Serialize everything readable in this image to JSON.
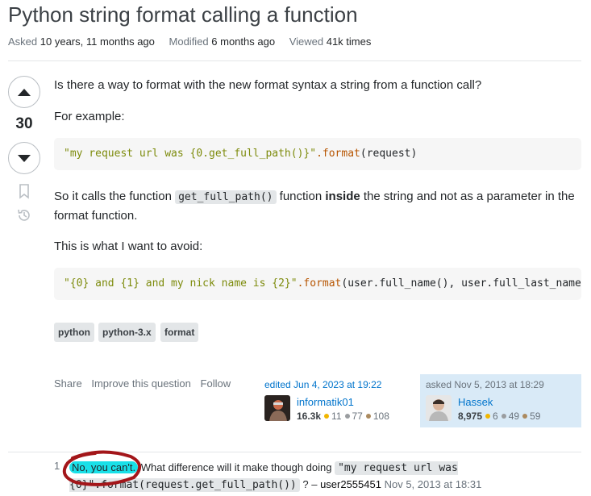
{
  "question": {
    "title": "Python string format calling a function",
    "meta": {
      "asked_label": "Asked",
      "asked_value": "10 years, 11 months ago",
      "modified_label": "Modified",
      "modified_value": "6 months ago",
      "viewed_label": "Viewed",
      "viewed_value": "41k times"
    },
    "score": "30",
    "paragraphs": {
      "p1": "Is there a way to format with the new format syntax a string from a function call?",
      "p2": "For example:",
      "p3_a": "So it calls the function ",
      "p3_code": "get_full_path()",
      "p3_b": " function ",
      "p3_bold": "inside",
      "p3_c": " the string and not as a parameter in the format function.",
      "p4": "This is what I want to avoid:"
    },
    "code1": {
      "str": "\"my request url was {0.get_full_path()}\"",
      "fn": ".format",
      "rest": "(request)"
    },
    "code2": {
      "str": "\"{0} and {1} and my nick name is {2}\"",
      "fn": ".format",
      "rest": "(user.full_name(), user.full_last_name(), user.nick_name)"
    },
    "tags": [
      "python",
      "python-3.x",
      "format"
    ],
    "actions": {
      "share": "Share",
      "improve": "Improve this question",
      "follow": "Follow"
    },
    "edited": {
      "time": "edited Jun 4, 2023 at 19:22",
      "user": "informatik01",
      "rep": "16.3k",
      "gold": "11",
      "silver": "77",
      "bronze": "108"
    },
    "asked": {
      "time": "asked Nov 5, 2013 at 18:29",
      "user": "Hassek",
      "rep": "8,975",
      "gold": "6",
      "silver": "49",
      "bronze": "59"
    }
  },
  "comment": {
    "score": "1",
    "highlight": "No, you can't.",
    "text_a": " What difference will it make though doing ",
    "code": "\"my request url was {0}\".format(request.get_full_path())",
    "text_b": " ? – ",
    "user": "user2555451",
    "date": "Nov 5, 2013 at 18:31"
  },
  "colors": {
    "link": "#0074cc",
    "highlight": "#19e0e8",
    "annotation": "#a3161a"
  }
}
